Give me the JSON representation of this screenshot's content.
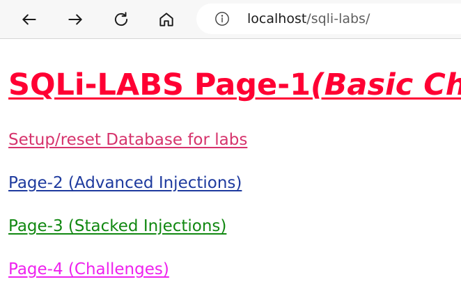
{
  "browser": {
    "url_host": "localhost",
    "url_path": "/sqli-labs/",
    "icons": {
      "back": "arrow-left",
      "forward": "arrow-right",
      "reload": "reload",
      "home": "home",
      "site_info": "info-circle"
    }
  },
  "page": {
    "title": "SQLi-LABS Page-1",
    "title_suffix": "(Basic Ch",
    "title_color": "#ff0033",
    "links": {
      "setup": "Setup/reset Database for labs",
      "page2": "Page-2 (Advanced Injections)",
      "page3": "Page-3 (Stacked Injections)",
      "page4": "Page-4 (Challenges)"
    },
    "link_colors": {
      "setup": "#d6336c",
      "page2": "#1e3a9e",
      "page3": "#118811",
      "page4": "#ee22ee"
    }
  }
}
